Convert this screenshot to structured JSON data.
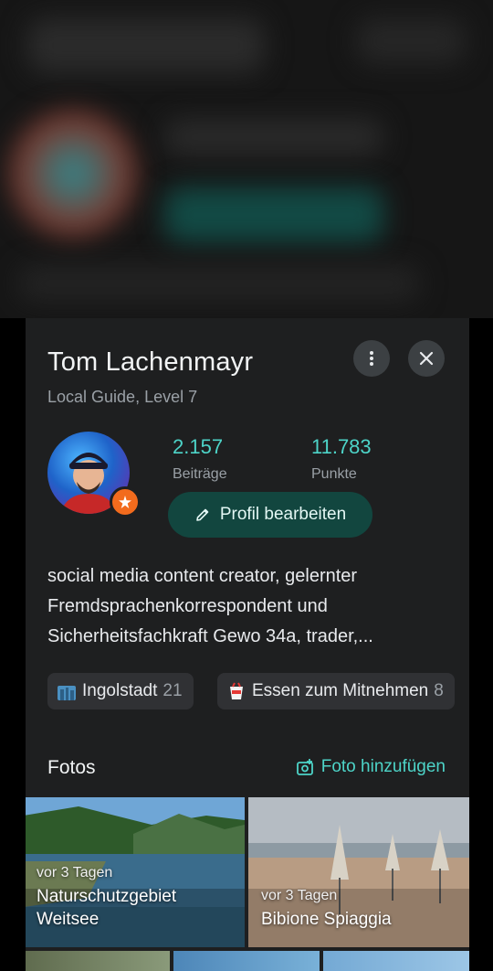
{
  "profile": {
    "name": "Tom Lachenmayr",
    "level": "Local Guide, Level 7",
    "avatar_icon": "user-avatar",
    "badge_icon": "star-icon",
    "stats": [
      {
        "value": "2.157",
        "label": "Beiträge"
      },
      {
        "value": "11.783",
        "label": "Punkte"
      }
    ],
    "edit_label": "Profil bearbeiten",
    "bio": "social media content creator, gelernter Fremdsprachenkorrespondent und Sicherheitsfachkraft Gewo 34a, trader,...",
    "chips": [
      {
        "label": "Ingolstadt",
        "count": "21",
        "icon": "city-icon"
      },
      {
        "label": "Essen zum Mitnehmen",
        "count": "8",
        "icon": "takeout-icon"
      }
    ]
  },
  "photos": {
    "title": "Fotos",
    "add_label": "Foto hinzufügen",
    "items": [
      {
        "age": "vor 3 Tagen",
        "place": "Naturschutzgebiet Weitsee"
      },
      {
        "age": "vor 3 Tagen",
        "place": "Bibione Spiaggia"
      }
    ]
  },
  "colors": {
    "accent": "#4dd4c8",
    "sheet": "#1e1f20",
    "chip": "#303134"
  }
}
